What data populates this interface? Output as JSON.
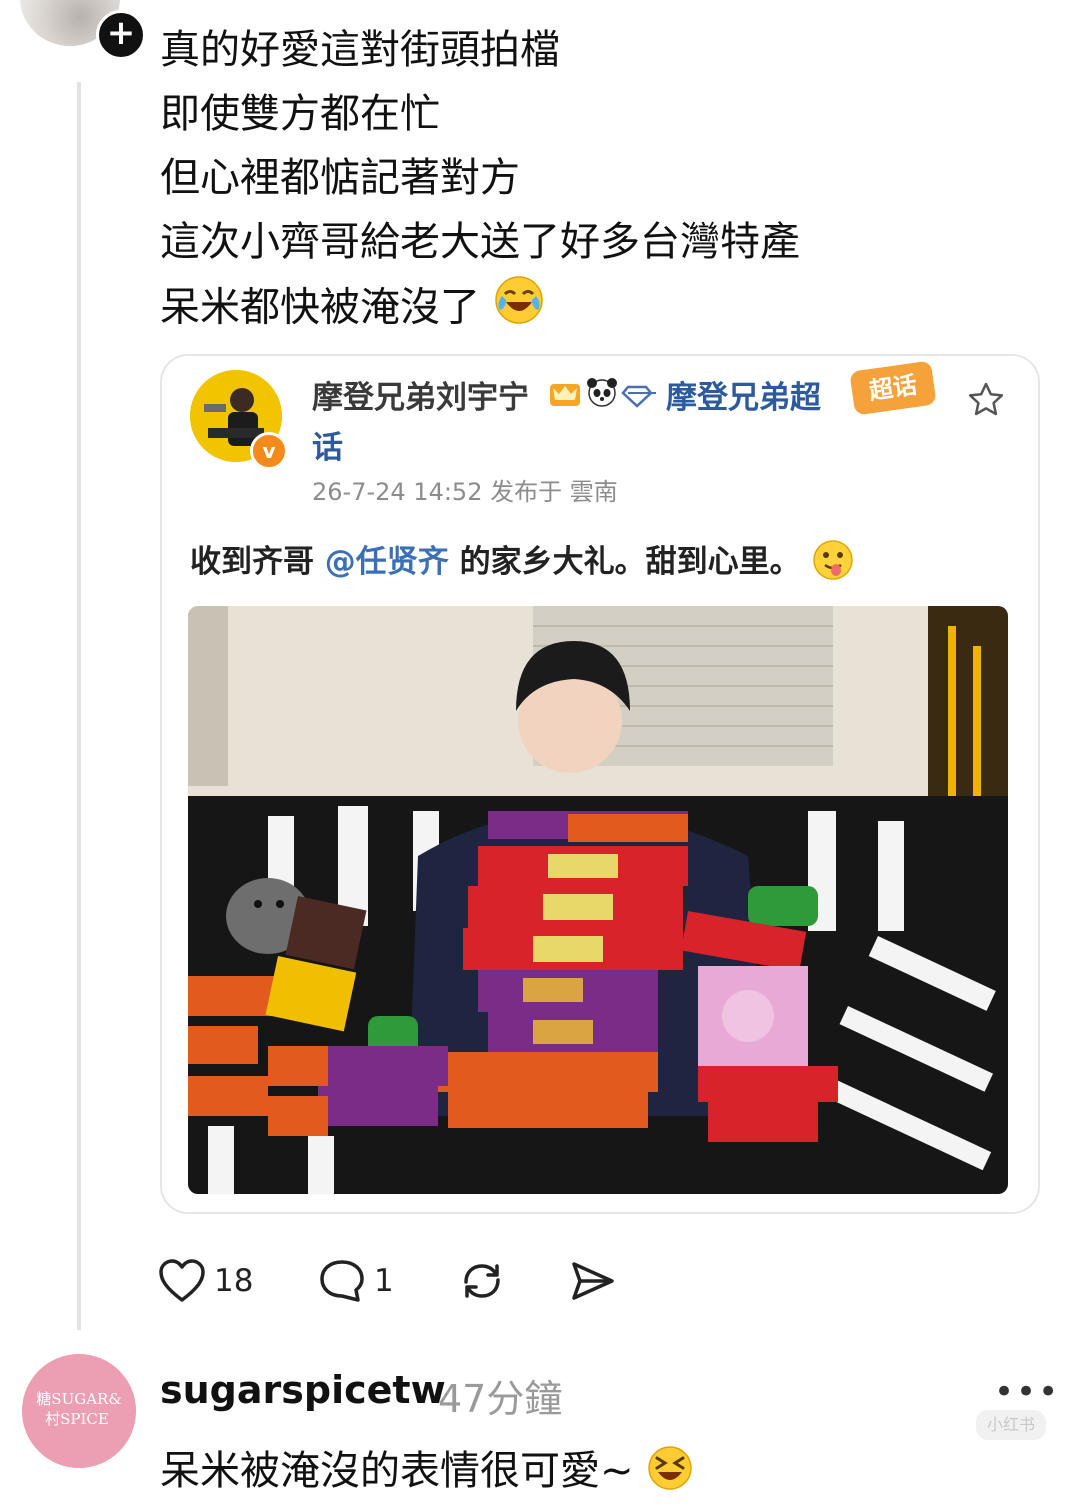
{
  "post": {
    "lines": [
      "真的好愛這對街頭拍檔",
      "即使雙方都在忙",
      "但心裡都惦記著對方",
      "這次小齊哥給老大送了好多台灣特產",
      "呆米都快被淹沒了"
    ],
    "line5_emoji": "laughing-tears-emoji"
  },
  "card": {
    "author": "摩登兄弟刘宇宁",
    "topic_part1": "摩登兄弟超",
    "topic_part2": "话",
    "chaohua_badge": "超话",
    "meta": "26-7-24 14:52  发布于 雲南",
    "text_before": "收到齐哥 ",
    "mention": "@任贤齐",
    "text_after": " 的家乡大礼。甜到心里。",
    "text_emoji": "tongue-out-emoji"
  },
  "actions": {
    "likes": "18",
    "comments": "1"
  },
  "reply": {
    "username": "sugarspicetw",
    "time": "47分鐘",
    "text": "呆米被淹沒的表情很可愛~",
    "avatar_text_1": "糖SUGAR&",
    "avatar_text_2": "村SPICE"
  },
  "watermark": "小红书",
  "colors": {
    "mention": "#3b6fb6",
    "topic": "#2d5a9e",
    "chaohua": "#f6a23a",
    "verified": "#f48a1a"
  }
}
